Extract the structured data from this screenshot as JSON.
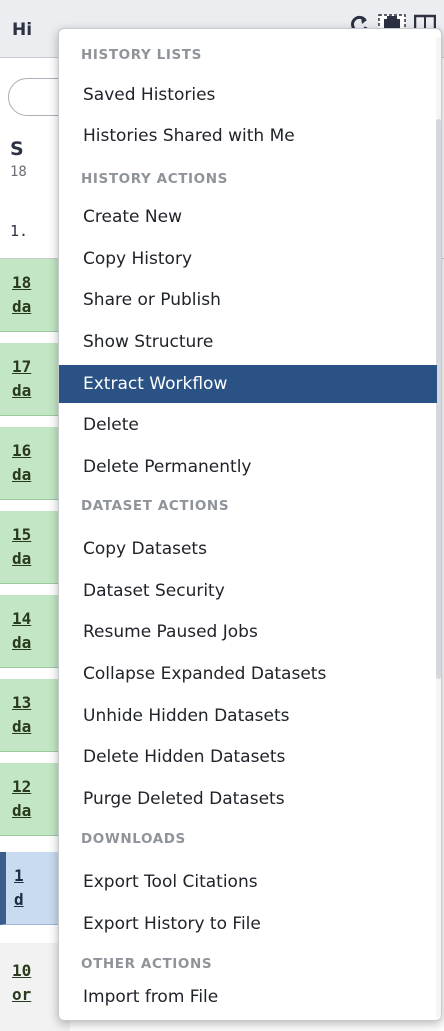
{
  "panel": {
    "title": "Hi",
    "history_name": "S",
    "history_size": "18",
    "history_count": "1.",
    "datasets": [
      {
        "line1": "18",
        "line2": "da"
      },
      {
        "line1": "17",
        "line2": "da"
      },
      {
        "line1": "16",
        "line2": "da"
      },
      {
        "line1": "15",
        "line2": "da"
      },
      {
        "line1": "14",
        "line2": "da"
      },
      {
        "line1": "13",
        "line2": "da"
      },
      {
        "line1": "12",
        "line2": "da"
      },
      {
        "line1": "1",
        "line2": "d"
      },
      {
        "line1": "10",
        "line2": "or"
      }
    ],
    "icons": [
      "refresh-icon",
      "options-menu-icon",
      "columns-icon"
    ]
  },
  "menu": {
    "headers": {
      "history_lists": "HISTORY LISTS",
      "history_actions": "HISTORY ACTIONS",
      "dataset_actions": "DATASET ACTIONS",
      "downloads": "DOWNLOADS",
      "other_actions": "OTHER ACTIONS"
    },
    "items": {
      "saved_histories": "Saved Histories",
      "histories_shared": "Histories Shared with Me",
      "create_new": "Create New",
      "copy_history": "Copy History",
      "share_or_publish": "Share or Publish",
      "show_structure": "Show Structure",
      "extract_workflow": "Extract Workflow",
      "delete": "Delete",
      "delete_permanently": "Delete Permanently",
      "copy_datasets": "Copy Datasets",
      "dataset_security": "Dataset Security",
      "resume_paused_jobs": "Resume Paused Jobs",
      "collapse_expanded": "Collapse Expanded Datasets",
      "unhide_hidden": "Unhide Hidden Datasets",
      "delete_hidden": "Delete Hidden Datasets",
      "purge_deleted": "Purge Deleted Datasets",
      "export_tool_citations": "Export Tool Citations",
      "export_history_to_file": "Export History to File",
      "import_from_file": "Import from File"
    },
    "highlighted_item": "Extract Workflow"
  },
  "colors": {
    "highlight": "#2b5284",
    "section_header": "#8f949a",
    "dataset_ok": "#c3e6c4",
    "dataset_paused": "#c9dbf0"
  }
}
